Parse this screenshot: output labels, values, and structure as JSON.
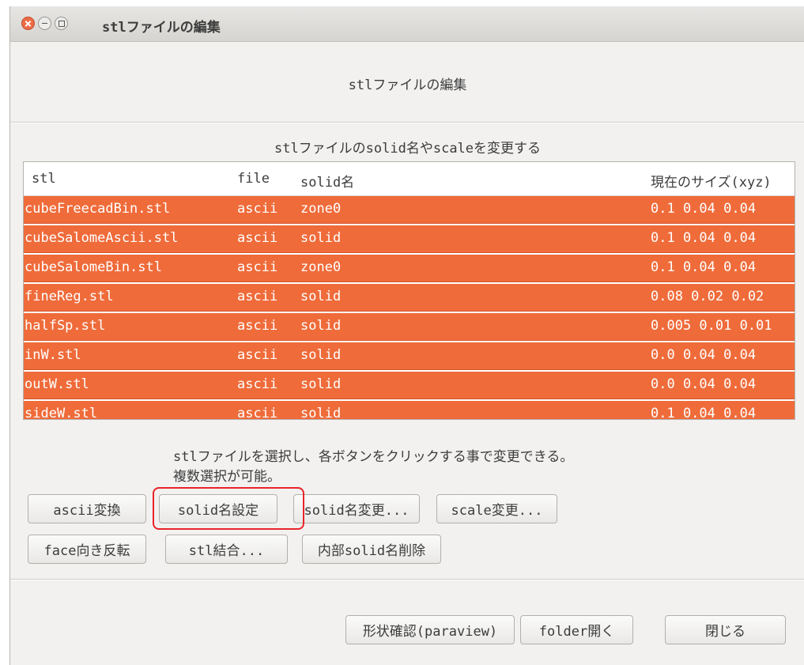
{
  "window": {
    "title": "stlファイルの編集",
    "heading": "stlファイルの編集"
  },
  "table": {
    "caption": "stlファイルのsolid名やscaleを変更する",
    "columns": [
      "stl",
      "file",
      "solid名",
      "現在のサイズ(xyz)"
    ],
    "rows": [
      {
        "stl": "cubeFreecadBin.stl",
        "file": "ascii",
        "solid": "zone0",
        "size": "0.1 0.04 0.04"
      },
      {
        "stl": "cubeSalomeAscii.stl",
        "file": "ascii",
        "solid": "solid",
        "size": "0.1 0.04 0.04"
      },
      {
        "stl": "cubeSalomeBin.stl",
        "file": "ascii",
        "solid": "zone0",
        "size": "0.1 0.04 0.04"
      },
      {
        "stl": "fineReg.stl",
        "file": "ascii",
        "solid": "solid",
        "size": "0.08 0.02 0.02"
      },
      {
        "stl": "halfSp.stl",
        "file": "ascii",
        "solid": "solid",
        "size": "0.005 0.01 0.01"
      },
      {
        "stl": "inW.stl",
        "file": "ascii",
        "solid": "solid",
        "size": "0.0 0.04 0.04"
      },
      {
        "stl": "outW.stl",
        "file": "ascii",
        "solid": "solid",
        "size": "0.0 0.04 0.04"
      },
      {
        "stl": "sideW.stl",
        "file": "ascii",
        "solid": "solid",
        "size": "0.1 0.04 0.04"
      }
    ],
    "selection_color": "#ef6b3a"
  },
  "instructions": {
    "line1": "stlファイルを選択し、各ボタンをクリックする事で変更できる。",
    "line2": "複数選択が可能。"
  },
  "buttons": {
    "ascii": "ascii変換",
    "solid_set": "solid名設定",
    "solid_change": "solid名変更...",
    "scale_change": "scale変更...",
    "face_flip": "face向き反転",
    "stl_merge": "stl結合...",
    "inner_solid_delete": "内部solid名削除",
    "paraview": "形状確認(paraview)",
    "folder_open": "folder開く",
    "close": "閉じる"
  },
  "colors": {
    "highlight": "#e8242a",
    "close_button": "#ec6b45"
  }
}
